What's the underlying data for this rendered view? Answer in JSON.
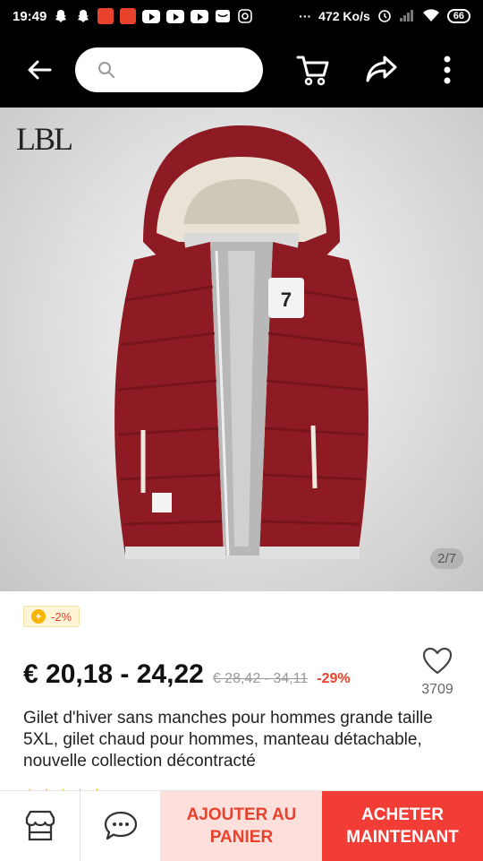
{
  "status_bar": {
    "time": "19:49",
    "network_speed": "472 Ko/s",
    "battery": "66",
    "icons": [
      "snapchat-icon",
      "snapchat-icon",
      "aliexpress-icon",
      "aliexpress-icon",
      "youtube-icon",
      "youtube-icon",
      "youtube-icon",
      "mail-icon",
      "instagram-icon",
      "more-dots-icon",
      "alarm-icon",
      "signal-icon",
      "wifi-icon",
      "battery-icon"
    ]
  },
  "toolbar": {
    "search_placeholder": "",
    "icons": [
      "back-arrow-icon",
      "search-icon",
      "cart-icon",
      "share-icon",
      "more-vertical-icon"
    ]
  },
  "gallery": {
    "brand_logo": "LBL",
    "counter": "2/7"
  },
  "product": {
    "coupon": "-2%",
    "price": "€ 20,18 - 24,22",
    "old_price": "€ 28,42 - 34,11",
    "discount": "-29%",
    "wishlist_count": "3709",
    "title": "Gilet d'hiver sans manches pour hommes grande taille 5XL, gilet chaud pour hommes, manteau détachable, nouvelle collection décontracté"
  },
  "bottom_bar": {
    "add_to_cart": "AJOUTER AU PANIER",
    "buy_now": "ACHETER MAINTENANT",
    "icons": [
      "store-icon",
      "chat-icon"
    ]
  },
  "colors": {
    "accent_red": "#f23c36",
    "light_red": "#fde0dc",
    "vest_red": "#8e1b24"
  }
}
